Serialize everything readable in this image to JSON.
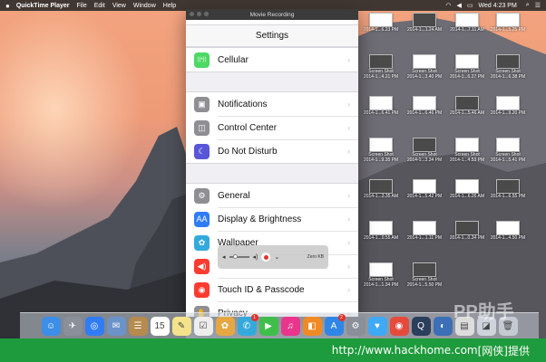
{
  "menubar": {
    "app_name": "QuickTime Player",
    "items": [
      "File",
      "Edit",
      "View",
      "Window",
      "Help"
    ],
    "clock": "Wed 4:23 PM"
  },
  "window": {
    "title": "Movie Recording"
  },
  "settings": {
    "header": "Settings",
    "groups": [
      [
        {
          "label": "Cellular",
          "color": "#4cd964",
          "icon": "cellular-icon"
        }
      ],
      [
        {
          "label": "Notifications",
          "color": "#8e8e93",
          "icon": "notifications-icon"
        },
        {
          "label": "Control Center",
          "color": "#8e8e93",
          "icon": "control-center-icon"
        },
        {
          "label": "Do Not Disturb",
          "color": "#5856d6",
          "icon": "moon-icon"
        }
      ],
      [
        {
          "label": "General",
          "color": "#8e8e93",
          "icon": "gear-icon"
        },
        {
          "label": "Display & Brightness",
          "color": "#2f7cf6",
          "icon": "brightness-icon"
        },
        {
          "label": "Wallpaper",
          "color": "#34aadc",
          "icon": "wallpaper-icon"
        },
        {
          "label": "",
          "color": "#ff3b30",
          "icon": "sounds-icon"
        },
        {
          "label": "Touch ID & Passcode",
          "color": "#ff3b30",
          "icon": "fingerprint-icon"
        },
        {
          "label": "Privacy",
          "color": "#8e8e93",
          "icon": "hand-icon"
        }
      ]
    ]
  },
  "recording": {
    "size": "Zero KB"
  },
  "desktop_icons": [
    {
      "label1": "",
      "label2": "2014-1...6.23 PM"
    },
    {
      "label1": "",
      "label2": "2014-1...1.24 AM"
    },
    {
      "label1": "",
      "label2": "2014-1...7.11 AM"
    },
    {
      "label1": "",
      "label2": "2014-1...5.25 PM"
    },
    {
      "label1": "Screen Shot",
      "label2": "2014-1...4.21 PM"
    },
    {
      "label1": "Screen Shot",
      "label2": "2014-1...3.40 PM"
    },
    {
      "label1": "Screen Shot",
      "label2": "2014-1...6.27 PM"
    },
    {
      "label1": "Screen Shot",
      "label2": "2014-1...6.38 PM"
    },
    {
      "label1": "",
      "label2": "2014-1...6.41 PM"
    },
    {
      "label1": "",
      "label2": "2014-1...6.46 PM"
    },
    {
      "label1": "",
      "label2": "2014-1...5.46 AM"
    },
    {
      "label1": "",
      "label2": "2014-1...9.20 PM"
    },
    {
      "label1": "Screen Shot",
      "label2": "2014-1...9.35 PM"
    },
    {
      "label1": "Screen Shot",
      "label2": "2014-1...3.34 PM"
    },
    {
      "label1": "Screen Shot",
      "label2": "2014-1...4.53 PM"
    },
    {
      "label1": "Screen Shot",
      "label2": "2014-1...5.41 PM"
    },
    {
      "label1": "",
      "label2": "2014-1...3.35 AM"
    },
    {
      "label1": "",
      "label2": "2014-1...5.42 PM"
    },
    {
      "label1": "",
      "label2": "2014-1...6.26 AM"
    },
    {
      "label1": "",
      "label2": "2014-1...6.55 PM"
    },
    {
      "label1": "",
      "label2": "2014-1...0.55 AM"
    },
    {
      "label1": "",
      "label2": "2014-1...1.11 PM"
    },
    {
      "label1": "",
      "label2": "2014-1...0.34 PM"
    },
    {
      "label1": "",
      "label2": "2014-1...4.50 PM"
    },
    {
      "label1": "Screen Shot",
      "label2": "2014-1...1.34 PM"
    },
    {
      "label1": "Screen Shot",
      "label2": "2014-1...5.50 PM"
    }
  ],
  "dock": {
    "apps": [
      {
        "name": "finder-icon",
        "color": "#3d8ee6",
        "glyph": "☺",
        "badge": ""
      },
      {
        "name": "launchpad-icon",
        "color": "#8a8f99",
        "glyph": "✈",
        "badge": ""
      },
      {
        "name": "safari-icon",
        "color": "#2f7cf6",
        "glyph": "◎",
        "badge": ""
      },
      {
        "name": "mail-icon",
        "color": "#6c93c8",
        "glyph": "✉",
        "badge": ""
      },
      {
        "name": "contacts-icon",
        "color": "#b78a4e",
        "glyph": "☰",
        "badge": ""
      },
      {
        "name": "calendar-icon",
        "color": "#ffffff",
        "glyph": "15",
        "badge": ""
      },
      {
        "name": "notes-icon",
        "color": "#f4e38a",
        "glyph": "✎",
        "badge": ""
      },
      {
        "name": "reminders-icon",
        "color": "#eeeeee",
        "glyph": "☑",
        "badge": ""
      },
      {
        "name": "photos-icon",
        "color": "#e6a742",
        "glyph": "✿",
        "badge": ""
      },
      {
        "name": "messages-icon",
        "color": "#34aadc",
        "glyph": "✆",
        "badge": "1"
      },
      {
        "name": "facetime-icon",
        "color": "#3fbf4a",
        "glyph": "▶",
        "badge": ""
      },
      {
        "name": "itunes-icon",
        "color": "#e9358b",
        "glyph": "♫",
        "badge": ""
      },
      {
        "name": "ibooks-icon",
        "color": "#f08a24",
        "glyph": "◧",
        "badge": ""
      },
      {
        "name": "app-store-icon",
        "color": "#2f86e6",
        "glyph": "A",
        "badge": "2"
      },
      {
        "name": "system-preferences-icon",
        "color": "#8a8f99",
        "glyph": "⚙",
        "badge": ""
      },
      {
        "name": "twitter-icon",
        "color": "#3fa9f5",
        "glyph": "♥",
        "badge": ""
      },
      {
        "name": "chrome-icon",
        "color": "#e64a3b",
        "glyph": "◉",
        "badge": ""
      },
      {
        "name": "quicktime-icon",
        "color": "#2b3e5b",
        "glyph": "Q",
        "badge": ""
      },
      {
        "name": "app-icon",
        "color": "#3b6fb6",
        "glyph": "◐",
        "badge": ""
      },
      {
        "name": "preview-icon",
        "color": "#dddddd",
        "glyph": "▤",
        "badge": ""
      },
      {
        "name": "document-icon",
        "color": "#cfd4dc",
        "glyph": "◪",
        "badge": ""
      },
      {
        "name": "trash-icon",
        "color": "#c5cad2",
        "glyph": "🗑",
        "badge": ""
      }
    ]
  },
  "watermark": "PP助手",
  "banner": {
    "url_text": "http://www.hackhome.com",
    "suffix": "[网侠]提供"
  }
}
